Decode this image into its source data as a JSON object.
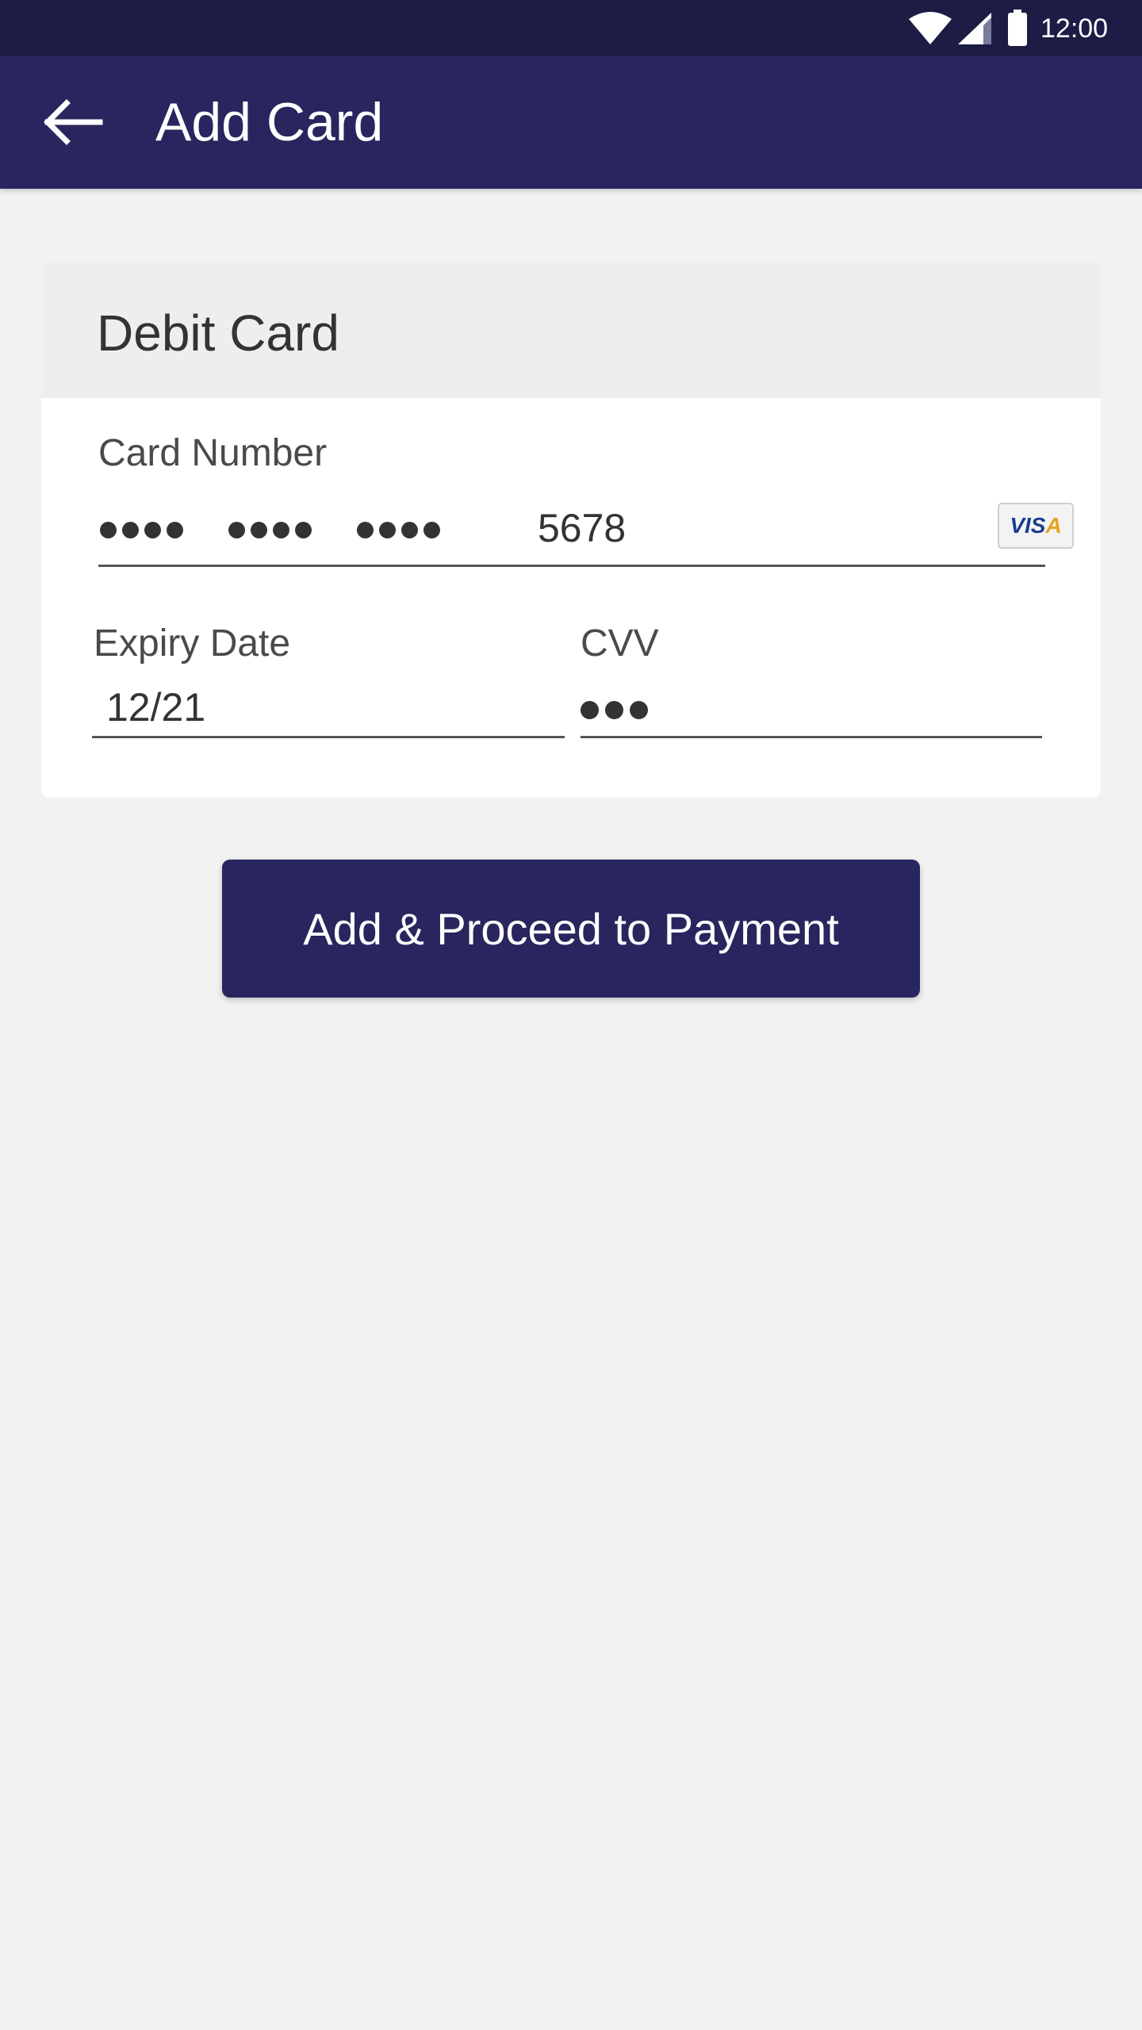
{
  "status_bar": {
    "time": "12:00",
    "icons": [
      "wifi-icon",
      "cell-signal-icon",
      "battery-icon"
    ]
  },
  "app_bar": {
    "title": "Add Card",
    "back_icon": "arrow-left-icon"
  },
  "card_form": {
    "section_title": "Debit Card",
    "card_number": {
      "label": "Card Number",
      "masked_groups": 3,
      "last_four": "5678",
      "brand": "VISA"
    },
    "expiry": {
      "label": "Expiry Date",
      "value": "12/21"
    },
    "cvv": {
      "label": "CVV",
      "masked_length": 3
    }
  },
  "actions": {
    "primary_label": "Add & Proceed to Payment"
  },
  "colors": {
    "status_bar": "#1c1c45",
    "app_bar": "#29255e",
    "primary_button": "#29255e",
    "background": "#f2f2f3",
    "card_header": "#eeeeef"
  }
}
